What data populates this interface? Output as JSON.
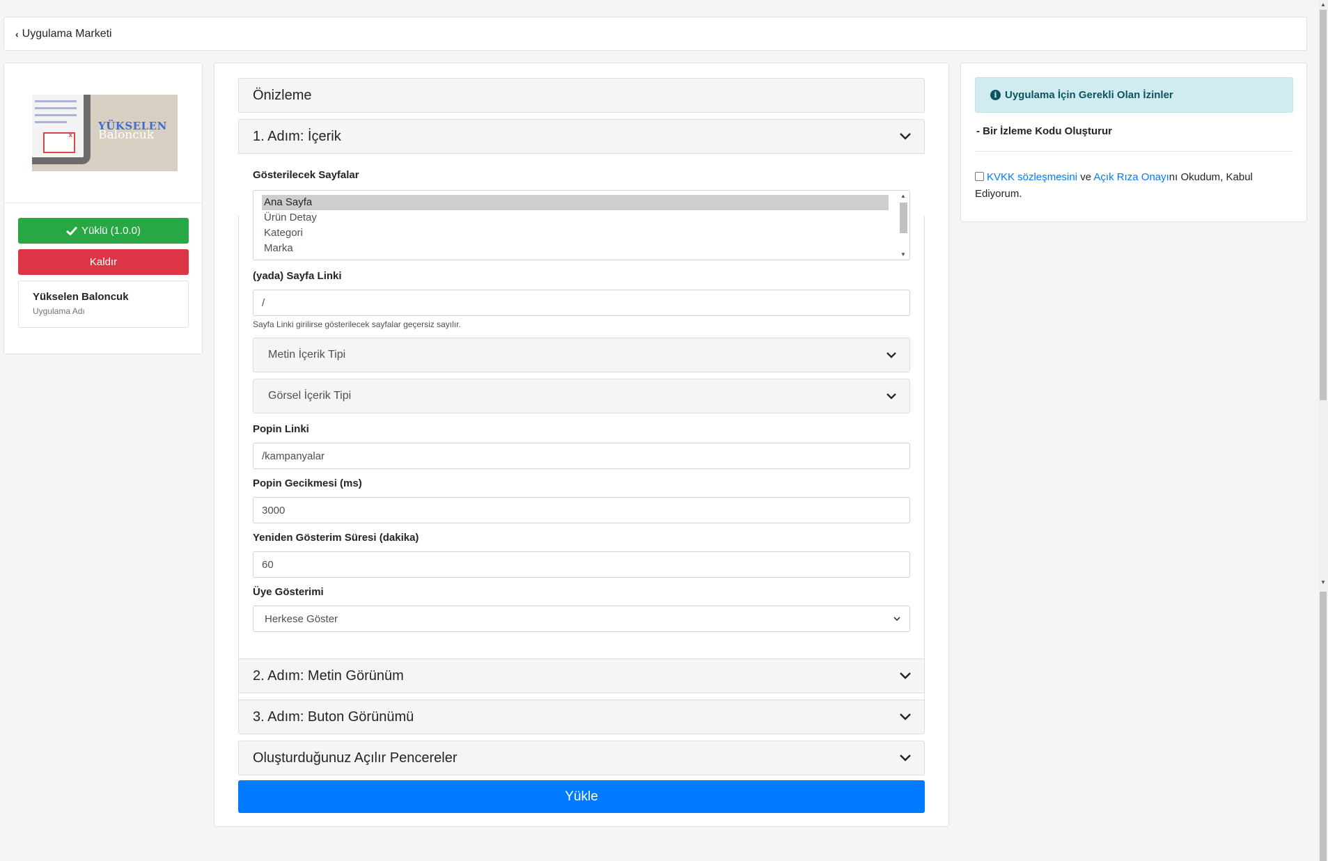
{
  "topbar": {
    "back_label": "Uygulama Marketi"
  },
  "app": {
    "image_title_1": "YÜKSELEN",
    "image_title_2": "Baloncuk",
    "installed_label": "Yüklü (1.0.0)",
    "remove_label": "Kaldır",
    "name": "Yükselen Baloncuk",
    "name_caption": "Uygulama Adı"
  },
  "main": {
    "preview_title": "Önizleme",
    "step1_title": "1. Adım: İçerik",
    "pages_label": "Gösterilecek Sayfalar",
    "pages_options": [
      "Ana Sayfa",
      "Ürün Detay",
      "Kategori",
      "Marka"
    ],
    "page_link_label": "(yada) Sayfa Linki",
    "page_link_value": "/",
    "page_link_hint": "Sayfa Linki girilirse gösterilecek sayfalar geçersiz sayılır.",
    "text_content_type": "Metin İçerik Tipi",
    "image_content_type": "Görsel İçerik Tipi",
    "popin_link_label": "Popin Linki",
    "popin_link_value": "/kampanyalar",
    "popin_delay_label": "Popin Gecikmesi (ms)",
    "popin_delay_value": "3000",
    "reshow_label": "Yeniden Gösterim Süresi (dakika)",
    "reshow_value": "60",
    "member_label": "Üye Gösterimi",
    "member_value": "Herkese Göster",
    "step2_title": "2. Adım: Metin Görünüm",
    "step3_title": "3. Adım: Buton Görünümü",
    "popups_title": "Oluşturduğunuz Açılır Pencereler",
    "submit_label": "Yükle"
  },
  "permissions": {
    "title": "Uygulama İçin Gerekli Olan İzinler",
    "item": "- Bir İzleme Kodu Oluşturur",
    "kvkk_link": "KVKK sözleşmesini",
    "and": "ve",
    "consent_link": "Açık Rıza Onayı",
    "consent_suffix": "nı Okudum, Kabul Ediyorum."
  },
  "colors": {
    "success": "#28a745",
    "danger": "#dc3545",
    "primary": "#007bff",
    "info_bg": "#d1ecf1",
    "info_text": "#0c5460"
  }
}
